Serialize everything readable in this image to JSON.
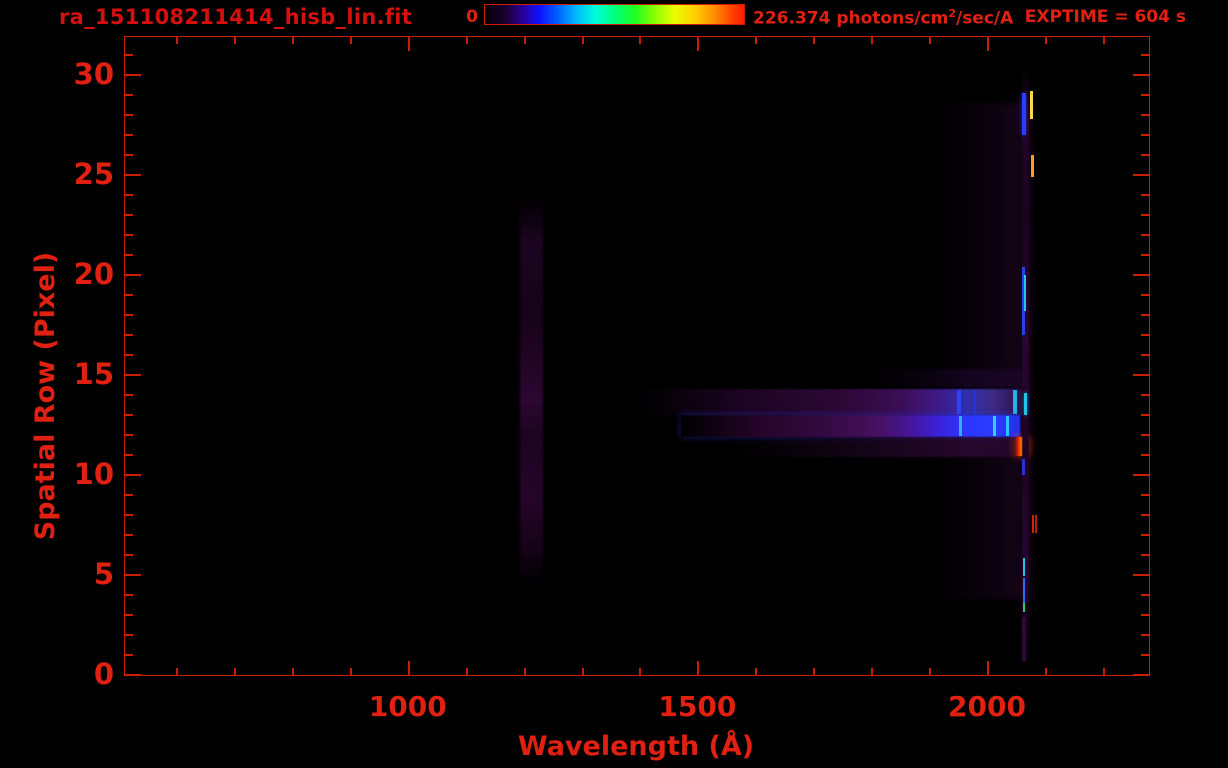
{
  "colors": {
    "background": "#000000",
    "accent_text": "#e02112",
    "title_text": "#d60f0f",
    "frame": "#cc1d00"
  },
  "header": {
    "title": "ra_151108211414_hisb_lin.fit",
    "exptime_label": "EXPTIME = 604 s",
    "colorbar": {
      "min_label": "0",
      "max_label_prefix": "226.374 photons/cm",
      "max_label_sup": "2",
      "max_label_suffix": "/sec/A",
      "gradient_stops": [
        [
          "#050008",
          "0%"
        ],
        [
          "#1c0030",
          "8%"
        ],
        [
          "#2a00a0",
          "15%"
        ],
        [
          "#1010ff",
          "21%"
        ],
        [
          "#0060ff",
          "28%"
        ],
        [
          "#00b8ff",
          "35%"
        ],
        [
          "#00ffd8",
          "43%"
        ],
        [
          "#00ff70",
          "51%"
        ],
        [
          "#20ff20",
          "58%"
        ],
        [
          "#90ff00",
          "66%"
        ],
        [
          "#e8ff00",
          "73%"
        ],
        [
          "#ffd000",
          "81%"
        ],
        [
          "#ff8800",
          "89%"
        ],
        [
          "#ff3c00",
          "96%"
        ],
        [
          "#ff1e00",
          "100%"
        ]
      ]
    }
  },
  "chart_data": {
    "type": "heatmap",
    "title": "ra_151108211414_hisb_lin.fit",
    "xlabel": "Wavelength (Å)",
    "ylabel": "Spatial Row (Pixel)",
    "exptime_seconds": 604,
    "colorbar": {
      "min": 0,
      "max": 226.374,
      "units": "photons/cm^2/sec/A",
      "colormap": "rainbow"
    },
    "axes": {
      "x": {
        "label": "Wavelength (Å)",
        "range": [
          510,
          2278
        ],
        "major_ticks": [
          {
            "value": 1000,
            "label": "1000"
          },
          {
            "value": 1500,
            "label": "1500"
          },
          {
            "value": 2000,
            "label": "2000"
          }
        ],
        "minor_start": 600,
        "minor_end": 2200,
        "minor_step": 100
      },
      "y": {
        "label": "Spatial Row (Pixel)",
        "range": [
          0,
          31.9
        ],
        "major_ticks": [
          {
            "value": 0,
            "label": "0"
          },
          {
            "value": 5,
            "label": "5"
          },
          {
            "value": 10,
            "label": "10"
          },
          {
            "value": 15,
            "label": "15"
          },
          {
            "value": 20,
            "label": "20"
          },
          {
            "value": 25,
            "label": "25"
          },
          {
            "value": 30,
            "label": "30"
          }
        ],
        "minor_start": 1,
        "minor_end": 31,
        "minor_step": 1
      }
    },
    "features": [
      {
        "name": "airglow-band-1216",
        "x": [
          1192,
          1232
        ],
        "rows": [
          4.5,
          24.0
        ],
        "dir": "v",
        "blur": 1.2,
        "stops": [
          [
            "rgba(15,1,18,0)",
            "0%"
          ],
          [
            "#1c0420",
            "12%"
          ],
          [
            "#170219",
            "30%"
          ],
          [
            "#240527",
            "45%"
          ],
          [
            "#2d0733",
            "52%"
          ],
          [
            "#1d0421",
            "62%"
          ],
          [
            "#260529",
            "78%"
          ],
          [
            "#170219",
            "90%"
          ],
          [
            "rgba(15,1,18,0)",
            "100%"
          ]
        ]
      },
      {
        "name": "diffuse-glow-right",
        "x": [
          1905,
          2078
        ],
        "rows": [
          3.8,
          28.6
        ],
        "dir": "h",
        "blur": 2,
        "stops": [
          [
            "rgba(30,4,36,0)",
            "0%"
          ],
          [
            "rgba(36,6,42,0.30)",
            "55%"
          ],
          [
            "rgba(44,8,52,0.42)",
            "82%"
          ],
          [
            "rgba(30,5,36,0.38)",
            "100%"
          ]
        ]
      },
      {
        "name": "streak-row15-faint",
        "x": [
          1790,
          2058
        ],
        "rows": [
          14.4,
          15.3
        ],
        "dir": "h",
        "blur": 1,
        "stops": [
          [
            "rgba(40,8,60,0)",
            "0%"
          ],
          [
            "rgba(48,12,78,0.35)",
            "70%"
          ],
          [
            "rgba(40,10,66,0.30)",
            "100%"
          ]
        ]
      },
      {
        "name": "streak-upper",
        "x": [
          1400,
          2058
        ],
        "rows": [
          13.0,
          14.3
        ],
        "dir": "h",
        "blur": 0.8,
        "stops": [
          [
            "rgba(24,3,30,0)",
            "0%"
          ],
          [
            "#1d0423",
            "28%"
          ],
          [
            "#2b0834",
            "52%"
          ],
          [
            "#3c0d55",
            "68%"
          ],
          [
            "#3d1a86",
            "78%"
          ],
          [
            "#2f2fae",
            "86%"
          ],
          [
            "#3c2b86",
            "92%"
          ],
          [
            "#2a0f4a",
            "100%"
          ]
        ]
      },
      {
        "name": "streak-upper-line-1950",
        "x": [
          1946,
          1953
        ],
        "rows": [
          13.05,
          14.25
        ],
        "color": "#2a46ff"
      },
      {
        "name": "streak-upper-line-1978",
        "x": [
          1975,
          1980
        ],
        "rows": [
          13.05,
          14.25
        ],
        "color": "#2436d8"
      },
      {
        "name": "streak-upper-line-2048",
        "x": [
          2044,
          2050
        ],
        "rows": [
          13.05,
          14.25
        ],
        "color": "#1fb6e0"
      },
      {
        "name": "streak-main",
        "x": [
          1470,
          2056
        ],
        "rows": [
          11.9,
          13.0
        ],
        "dir": "h",
        "blur": 0.6,
        "glow": "0 0 6px rgba(40,60,255,0.5)",
        "stops": [
          [
            "rgba(26,4,32,0)",
            "0%"
          ],
          [
            "#240528",
            "22%"
          ],
          [
            "#330a40",
            "42%"
          ],
          [
            "#471060",
            "58%"
          ],
          [
            "#46169c",
            "68%"
          ],
          [
            "#3a22d8",
            "76%"
          ],
          [
            "#2e35ff",
            "84%"
          ],
          [
            "#2b3cff",
            "92%"
          ],
          [
            "#2430e8",
            "100%"
          ]
        ]
      },
      {
        "name": "streak-main-line-1952",
        "x": [
          1950,
          1956
        ],
        "rows": [
          11.95,
          12.95
        ],
        "color": "#27b6ff"
      },
      {
        "name": "streak-main-line-2012",
        "x": [
          2009,
          2014
        ],
        "rows": [
          11.95,
          12.95
        ],
        "color": "#2bd2ff"
      },
      {
        "name": "streak-main-line-2034",
        "x": [
          2031,
          2036
        ],
        "rows": [
          11.95,
          12.95
        ],
        "color": "#29c4ff"
      },
      {
        "name": "streak-lower",
        "x": [
          1560,
          2044
        ],
        "rows": [
          10.9,
          11.9
        ],
        "dir": "h",
        "blur": 0.8,
        "stops": [
          [
            "rgba(30,5,36,0)",
            "0%"
          ],
          [
            "rgba(42,8,50,0.50)",
            "50%"
          ],
          [
            "rgba(56,12,66,0.65)",
            "85%"
          ],
          [
            "rgba(48,10,58,0.60)",
            "100%"
          ]
        ]
      },
      {
        "name": "bright-blob",
        "x": [
          2046,
          2070
        ],
        "rows": [
          10.95,
          11.9
        ],
        "dir": "h",
        "glow": "0 0 8px rgba(255,70,0,0.75)",
        "stops": [
          [
            "#6a0c20",
            "0%"
          ],
          [
            "#d42a06",
            "22%"
          ],
          [
            "#ff5a00",
            "38%"
          ],
          [
            "#ff9c00",
            "52%"
          ],
          [
            "#ff4a00",
            "68%"
          ],
          [
            "#c81e04",
            "82%"
          ],
          [
            "#50081a",
            "100%"
          ]
        ]
      },
      {
        "name": "emission-line-base",
        "x": [
          2058,
          2071
        ],
        "rows": [
          0.6,
          30.2
        ],
        "dir": "v",
        "blur": 0.5,
        "stops": [
          [
            "rgba(30,4,36,0.1)",
            "0%"
          ],
          [
            "#23052a",
            "8%"
          ],
          [
            "#1b0320",
            "25%"
          ],
          [
            "#2a0631",
            "45%"
          ],
          [
            "#1e0423",
            "65%"
          ],
          [
            "#270530",
            "85%"
          ],
          [
            "rgba(30,4,36,0.15)",
            "100%"
          ]
        ]
      },
      {
        "name": "line-seg-blue-top",
        "x": [
          2059,
          2065
        ],
        "rows": [
          27.0,
          29.1
        ],
        "color": "#2b3cff",
        "glow": "0 0 5px rgba(50,70,255,0.6)"
      },
      {
        "name": "line-seg-yellow-top",
        "x": [
          2073,
          2077
        ],
        "rows": [
          27.8,
          29.2
        ],
        "color": "#ffd84a"
      },
      {
        "name": "line-seg-orange-25",
        "x": [
          2074,
          2080
        ],
        "rows": [
          24.9,
          26.0
        ],
        "color": "#ff9d1e"
      },
      {
        "name": "line-seg-blue-19",
        "x": [
          2059,
          2064
        ],
        "rows": [
          17.0,
          20.4
        ],
        "color": "#2742e0"
      },
      {
        "name": "line-seg-cyan-19",
        "x": [
          2062,
          2066
        ],
        "rows": [
          18.2,
          20.0
        ],
        "color": "#21c6e8"
      },
      {
        "name": "line-seg-cyan-14",
        "x": [
          2062,
          2067
        ],
        "rows": [
          13.0,
          14.1
        ],
        "color": "#1fc8ea",
        "glow": "0 0 4px rgba(40,210,240,0.6)"
      },
      {
        "name": "line-seg-blue-10",
        "x": [
          2059,
          2064
        ],
        "rows": [
          10.0,
          10.8
        ],
        "color": "#2a33cc"
      },
      {
        "name": "line-seg-red-8a",
        "x": [
          2076,
          2079
        ],
        "rows": [
          7.1,
          8.0
        ],
        "color": "#d42408"
      },
      {
        "name": "line-seg-red-8b",
        "x": [
          2081,
          2084
        ],
        "rows": [
          7.1,
          8.0
        ],
        "color": "#b81e06"
      },
      {
        "name": "line-seg-cyan-5",
        "x": [
          2060,
          2064
        ],
        "rows": [
          4.95,
          5.85
        ],
        "color": "#1ec2e4"
      },
      {
        "name": "line-seg-blue-4",
        "x": [
          2060,
          2064
        ],
        "rows": [
          3.6,
          4.85
        ],
        "color": "#2a6cf0"
      },
      {
        "name": "line-seg-green-3",
        "x": [
          2060,
          2064
        ],
        "rows": [
          3.15,
          3.6
        ],
        "color": "#2ec868"
      },
      {
        "name": "line-seg-purple-bottom",
        "x": [
          2058,
          2066
        ],
        "rows": [
          0.7,
          2.9
        ],
        "color": "rgba(52,10,62,0.85)"
      }
    ]
  }
}
